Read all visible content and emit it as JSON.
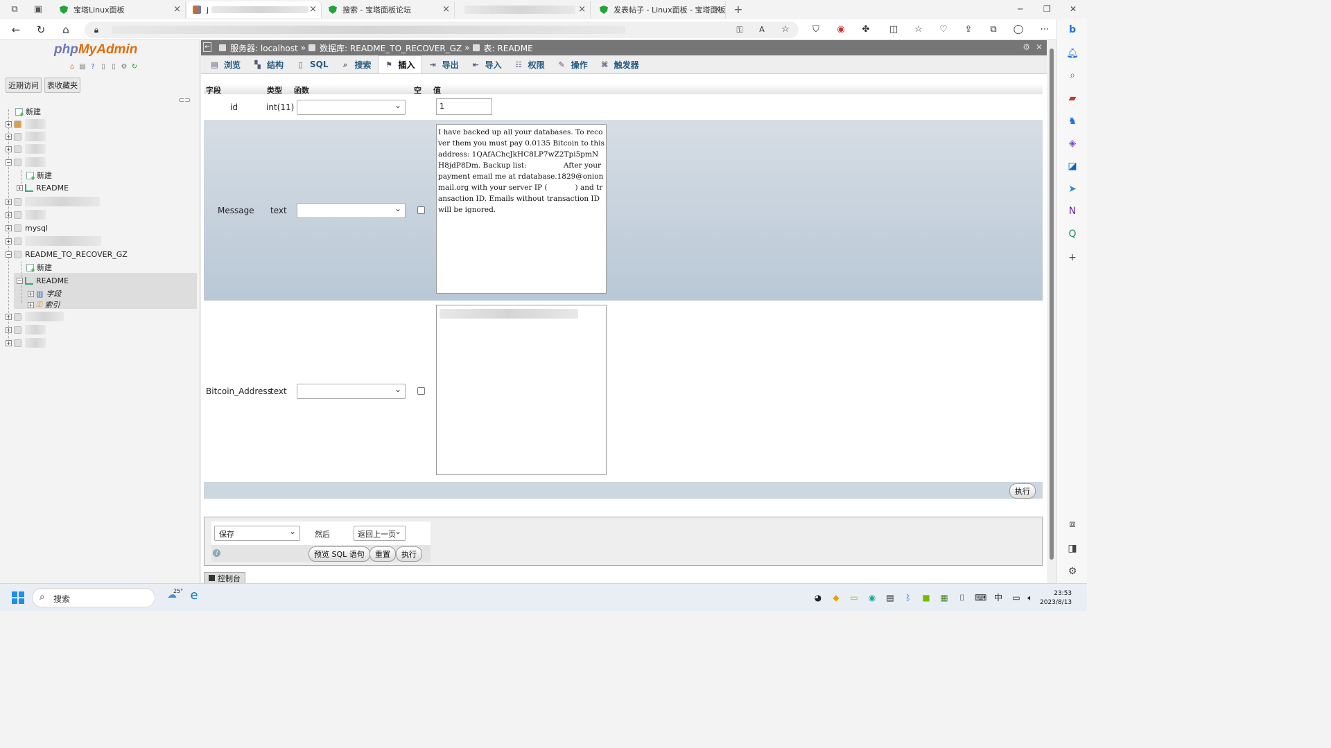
{
  "browser": {
    "tabs": [
      {
        "title": "宝塔Linux面板",
        "active": false
      },
      {
        "title": "j",
        "active": true
      },
      {
        "title": "搜索 - 宝塔面板论坛",
        "active": false
      },
      {
        "title": "",
        "active": false
      },
      {
        "title": "发表帖子 - Linux面板 - 宝塔面板",
        "active": false
      }
    ],
    "close_glyph": "×",
    "new_tab_glyph": "+"
  },
  "nav": {
    "logo_php": "php",
    "logo_my": "MyAdmin",
    "tab_recent": "近期访问",
    "tab_favorites": "表收藏夹",
    "tree": {
      "new_label": "新建",
      "readme_1": "README",
      "mysql": "mysql",
      "readme_db": "README_TO_RECOVER_GZ",
      "new_label_2": "新建",
      "readme_2": "README",
      "columns": "字段",
      "indexes": "索引"
    }
  },
  "breadcrumb": {
    "server": "服务器: localhost",
    "sep1": "»",
    "database": "数据库: README_TO_RECOVER_GZ",
    "sep2": "»",
    "table": "表: README"
  },
  "menu": {
    "tabs": [
      "浏览",
      "结构",
      "SQL",
      "搜索",
      "插入",
      "导出",
      "导入",
      "权限",
      "操作",
      "触发器"
    ],
    "active": "插入"
  },
  "insert_form": {
    "headers": {
      "field": "字段",
      "type": "类型",
      "function": "函数",
      "null": "空",
      "value": "值"
    },
    "rows": [
      {
        "field": "id",
        "type": "int(11)",
        "value": "1"
      },
      {
        "field": "Message",
        "type": "text",
        "value": "I have backed up all your databases. To recover them you must pay 0.0135 Bitcoin to this address: 1QAfAChcJkHC8LP7wZ2Tpi5pmNH8jdP8Dm. Backup list:                After your payment email me at rdatabase.1829@onionmail.org with your server IP (            ) and transaction ID. Emails without transaction ID will be ignored."
      },
      {
        "field": "Bitcoin_Address",
        "type": "text",
        "value": ""
      }
    ],
    "go_button": "执行"
  },
  "footer_form": {
    "action_select": "保存",
    "then_label": "然后",
    "after_select": "返回上一页",
    "preview_sql": "预览 SQL 语句",
    "reset": "重置",
    "go": "执行"
  },
  "console_label": "控制台",
  "taskbar": {
    "search_placeholder": "搜索",
    "weather": "25°",
    "ime": "中",
    "time": "23:53",
    "date": "2023/8/13"
  }
}
